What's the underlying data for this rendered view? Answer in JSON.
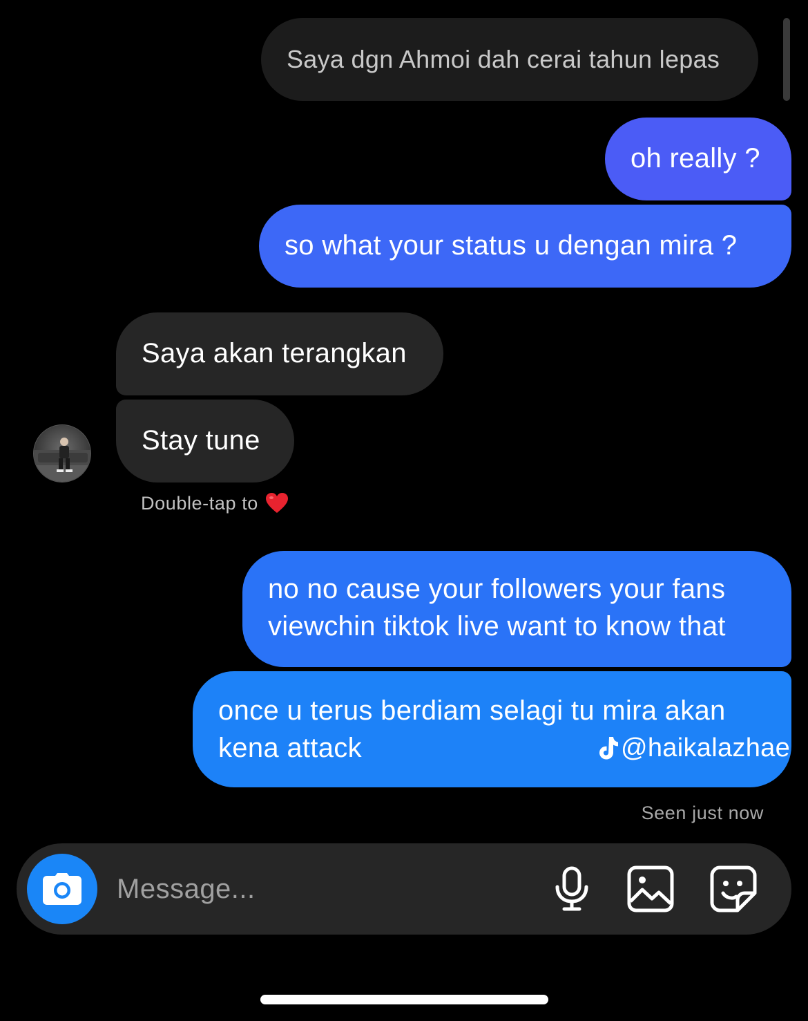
{
  "messages": [
    {
      "id": "msg-1",
      "direction": "incoming",
      "text": "Saya dgn Ahmoi dah cerai tahun lepas"
    },
    {
      "id": "msg-2",
      "direction": "outgoing",
      "text": "oh really ?"
    },
    {
      "id": "msg-3",
      "direction": "outgoing",
      "text": "so what your status u dengan mira ?"
    },
    {
      "id": "msg-4",
      "direction": "incoming",
      "text": "Saya akan terangkan"
    },
    {
      "id": "msg-5",
      "direction": "incoming",
      "text": "Stay tune"
    },
    {
      "id": "msg-6",
      "direction": "outgoing",
      "lines": [
        "no no cause your followers your fans",
        "viewchin tiktok live want to know that"
      ]
    },
    {
      "id": "msg-7",
      "direction": "outgoing",
      "lines": [
        "once u terus berdiam selagi tu mira akan",
        "kena attack"
      ]
    }
  ],
  "hint": {
    "text": "Double-tap to",
    "icon": "heart-icon"
  },
  "status": {
    "seen": "Seen just now"
  },
  "watermark": {
    "handle": "@haikalazhae",
    "icon": "tiktok-icon"
  },
  "composer": {
    "placeholder": "Message...",
    "camera_icon": "camera-icon",
    "mic_icon": "microphone-icon",
    "gallery_icon": "image-icon",
    "sticker_icon": "sticker-icon"
  },
  "colors": {
    "background": "#000000",
    "incoming_bubble": "#262626",
    "outgoing_top": "#4b5cf6",
    "outgoing_bottom": "#1d82f8",
    "camera_button": "#1a86f7",
    "heart": "#e8232f"
  }
}
